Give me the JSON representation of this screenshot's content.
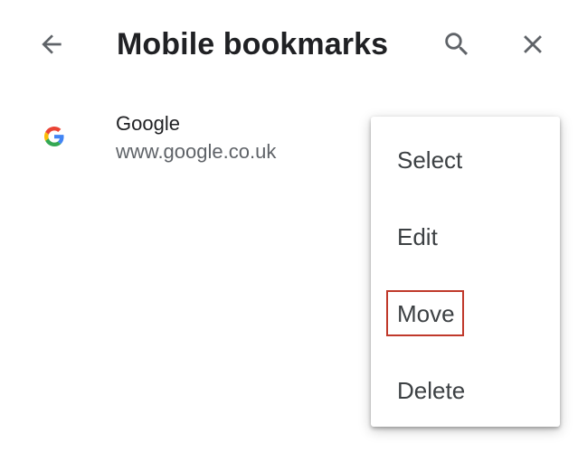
{
  "header": {
    "title": "Mobile bookmarks",
    "back_icon": "arrow-back-icon",
    "search_icon": "search-icon",
    "close_icon": "close-icon",
    "icon_color": "#5f6368"
  },
  "bookmarks": [
    {
      "title": "Google",
      "url": "www.google.co.uk",
      "favicon": "google-g-icon"
    }
  ],
  "menu": {
    "items": [
      {
        "label": "Select"
      },
      {
        "label": "Edit"
      },
      {
        "label": "Move",
        "highlighted": true,
        "highlight_color": "#c0392b"
      },
      {
        "label": "Delete"
      }
    ]
  }
}
